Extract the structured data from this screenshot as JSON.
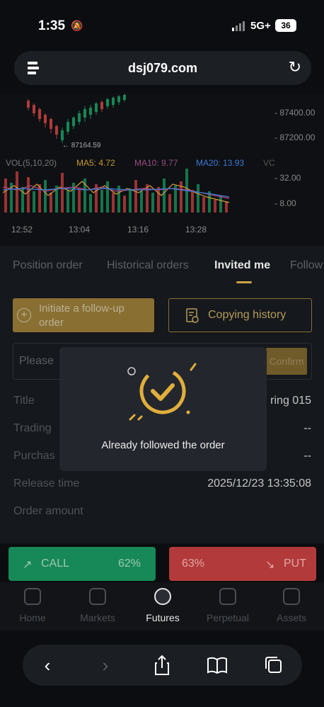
{
  "status": {
    "time": "1:35",
    "network": "5G+",
    "battery": "36"
  },
  "browser": {
    "url": "dsj079.com"
  },
  "chart": {
    "prices": [
      "- 87400.00",
      "- 87200.00",
      "- 32.00",
      "- 8.00"
    ],
    "low_label": "← 87164.59",
    "vol_label": "VOL(5,10,20)",
    "ma5": "MA5: 4.72",
    "ma10": "MA10: 9.77",
    "ma20": "MA20: 13.93",
    "vc": "VC",
    "times": [
      "12:52",
      "13:04",
      "13:16",
      "13:28"
    ]
  },
  "tabs": [
    "Position order",
    "Historical orders",
    "Invited me",
    "Follow"
  ],
  "actions": {
    "follow": "Initiate a follow-up order",
    "copying_history": "Copying history"
  },
  "search": {
    "placeholder": "Please",
    "confirm": "Confirm"
  },
  "rows": [
    {
      "label": "Title",
      "value": "ring 015"
    },
    {
      "label": "Trading",
      "value": "--"
    },
    {
      "label": "Purchas",
      "value": "--"
    },
    {
      "label": "Release time",
      "value": "2025/12/23 13:35:08"
    },
    {
      "label": "Order amount",
      "value": ""
    }
  ],
  "toast": {
    "message": "Already followed the order"
  },
  "trade": {
    "call_label": "CALL",
    "call_pct": "62%",
    "put_label": "PUT",
    "put_pct": "63%"
  },
  "nav": [
    "Home",
    "Markets",
    "Futures",
    "Perpetual",
    "Assets"
  ],
  "colors": {
    "accent": "#c9a24a",
    "call": "#178857",
    "put": "#b33a3a"
  }
}
